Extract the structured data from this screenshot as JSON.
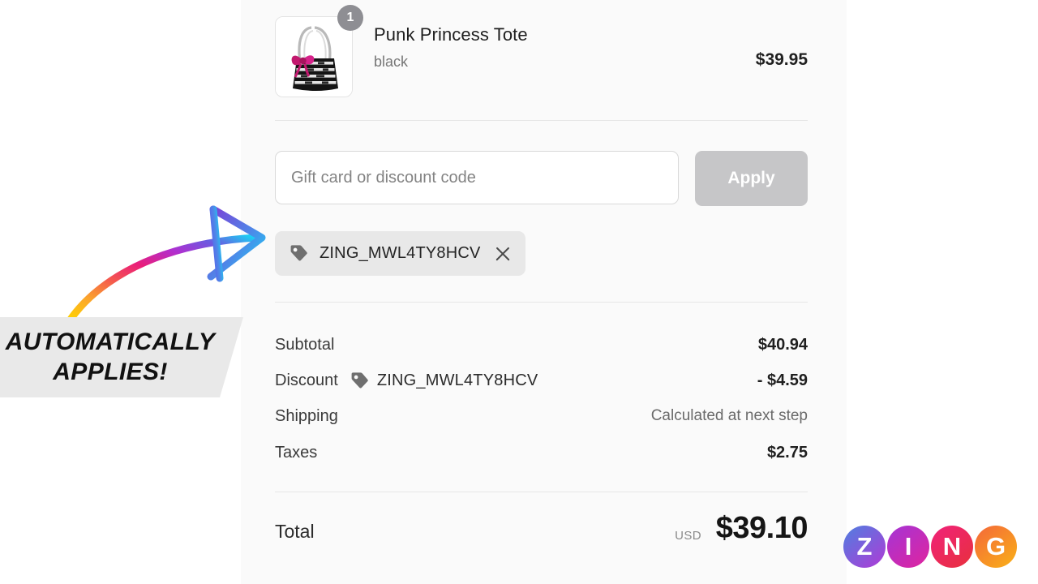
{
  "line_item": {
    "quantity": "1",
    "title": "Punk Princess Tote",
    "variant": "black",
    "price": "$39.95",
    "thumbnail_icon": "tote-bag-product-image"
  },
  "discount_form": {
    "input_value": "",
    "placeholder": "Gift card or discount code",
    "apply_label": "Apply"
  },
  "applied_discount": {
    "code": "ZING_MWL4TY8HCV",
    "tag_icon": "tag-icon",
    "remove_icon": "close-icon"
  },
  "summary": {
    "rows": [
      {
        "label": "Subtotal",
        "code": "",
        "value": "$40.94",
        "muted": false
      },
      {
        "label": "Discount",
        "code": "ZING_MWL4TY8HCV",
        "value": "- $4.59",
        "muted": false
      },
      {
        "label": "Shipping",
        "code": "",
        "value": "Calculated at next step",
        "muted": true
      },
      {
        "label": "Taxes",
        "code": "",
        "value": "$2.75",
        "muted": false
      }
    ]
  },
  "total": {
    "label": "Total",
    "currency": "USD",
    "amount": "$39.10"
  },
  "callout": {
    "line1": "AUTOMATICALLY",
    "line2": "APPLIES!",
    "arrow_icon": "curved-arrow-icon",
    "background": "#e9e9e9"
  },
  "brand": {
    "letters": [
      "Z",
      "I",
      "N",
      "G"
    ],
    "colors": [
      "#4f7fe0",
      "#a435d6",
      "#e0245e",
      "#f5a623"
    ]
  }
}
